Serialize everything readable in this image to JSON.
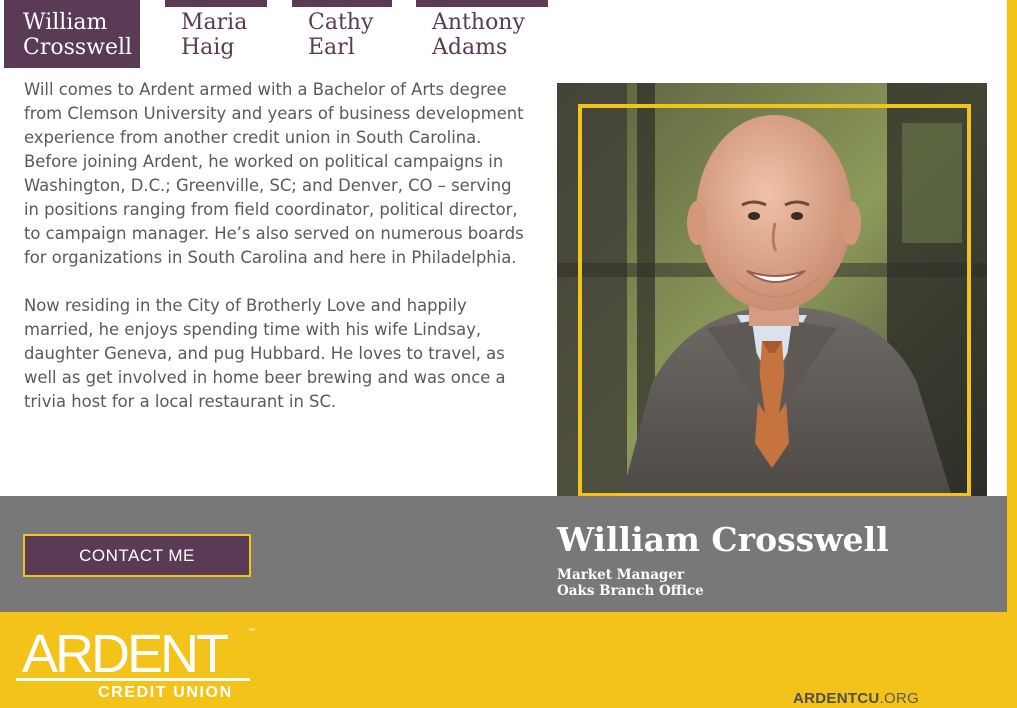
{
  "tabs": [
    {
      "line1": "William",
      "line2": "Crosswell",
      "active": true
    },
    {
      "line1": "Maria",
      "line2": "Haig",
      "active": false
    },
    {
      "line1": "Cathy",
      "line2": "Earl",
      "active": false
    },
    {
      "line1": "Anthony",
      "line2": "Adams",
      "active": false
    }
  ],
  "bio": {
    "paragraph1": "Will comes to Ardent armed with a Bachelor of Arts degree from Clemson University and years of business development experience from another credit union in South Carolina. Before joining Ardent, he worked on political campaigns in Washington, D.C.; Greenville, SC; and Denver, CO – serving in positions ranging from field coordinator, political director, to campaign manager. He’s also served on numerous boards for organizations in South Carolina and here in Philadelphia.",
    "paragraph2": "Now residing in the City of Brotherly Love and happily married, he enjoys spending time with his wife Lindsay, daughter Geneva, and pug Hubbard. He loves to travel, as well as get involved in home beer brewing and was once a trivia host for a local restaurant in SC."
  },
  "contact": {
    "label": "CONTACT ME"
  },
  "profile": {
    "name": "William Crosswell",
    "title": "Market Manager",
    "office": "Oaks Branch Office"
  },
  "logo": {
    "word": "ARDENT",
    "tm": "™",
    "sub": "CREDIT UNION"
  },
  "site": {
    "bold": "ARDENTCU",
    "light": ".ORG"
  },
  "colors": {
    "purple": "#5b3a55",
    "gold": "#f3c31a",
    "grey": "#787878",
    "text": "#5a5a5a"
  }
}
